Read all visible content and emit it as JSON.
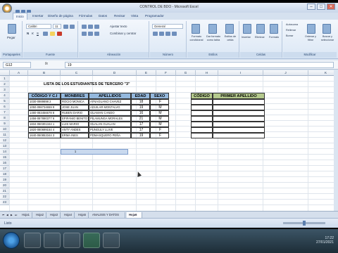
{
  "window": {
    "title": "CONTROL DE BDO - Microsoft Excel",
    "controls": [
      "–",
      "□",
      "✕"
    ]
  },
  "ribbon_tabs": [
    "Inicio",
    "Insertar",
    "Diseño de página",
    "Fórmulas",
    "Datos",
    "Revisar",
    "Vista",
    "Programador"
  ],
  "ribbon": {
    "paste_label": "Pegar",
    "font_name": "Calibri",
    "font_size": "11",
    "wrap_text": "Ajustar texto",
    "merge_center": "Combinar y centrar",
    "number_format": "General",
    "cond_format": "Formato condicional",
    "table_format": "Dar formato como tabla",
    "cell_styles": "Estilos de celda",
    "insert": "Insertar",
    "delete": "Eliminar",
    "format": "Formato",
    "autosum": "Autosuma",
    "fill": "Rellenar",
    "clear": "Borrar",
    "sort_filter": "Ordenar y filtrar",
    "find_select": "Buscar y seleccionar",
    "groups": [
      "Portapapeles",
      "Fuente",
      "Alineación",
      "Número",
      "Estilos",
      "Celdas",
      "Modificar"
    ]
  },
  "formula_bar": {
    "name_box": "G12",
    "fx": "fx",
    "value": "19"
  },
  "columns": [
    "A",
    "B",
    "C",
    "D",
    "E",
    "F",
    "G",
    "H",
    "I",
    "J",
    "K"
  ],
  "rows": [
    "1",
    "2",
    "3",
    "4",
    "5",
    "6",
    "7",
    "8",
    "9",
    "10",
    "11",
    "12",
    "13",
    "14",
    "15",
    "16",
    "17",
    "18",
    "19",
    "20",
    "21",
    "22",
    "23"
  ],
  "sheet_title": "LISTA DE LOS ESTUDIANTES DE TERCERO \"3\"",
  "table": {
    "headers": [
      "CÓDIGO Y C.I",
      "MONBRES",
      "APELLIDOS",
      "EDAD",
      "SEXO"
    ],
    "rows": [
      [
        "1030-0989898 2",
        "ROCIO MONICA",
        "AYNAGUANO CHAVEZ",
        "18",
        "F"
      ],
      [
        "1050-098734659 9",
        "JOSE JUAN",
        "AGUILAR MONTALVO",
        "19",
        "M"
      ],
      [
        "1480-083456678 8",
        "RUBEN DARIO",
        "GUAMAN CANDO",
        "16",
        "M"
      ],
      [
        "1456-087890377 6",
        "EPIFANIO BENITO",
        "PILAMUNGA MORALES",
        "21",
        "M"
      ],
      [
        "1834-060301344 1",
        "LUIS MARIO",
        "GUALAN GUALAN",
        "17",
        "M"
      ],
      [
        "1820-080699154 4",
        "ANTY ANDES",
        "PUNGULY LLIVE",
        "17",
        "F"
      ],
      [
        "1640-060853344 3",
        "ERMA INES",
        "POMASQUERO PEÑA",
        "19",
        "F"
      ]
    ]
  },
  "lookup": {
    "headers": [
      "CÓDIGO",
      "PRIMER APELLIDO"
    ]
  },
  "selected_cell_value": "1",
  "sheet_tabs": [
    "Hoja1",
    "Hoja2",
    "Hoja3",
    "Hoja4",
    "Hoja5",
    "ANALISIS Y DATOS",
    "Hoja6"
  ],
  "status": "Listo",
  "taskbar": {
    "clock_time": "17:22",
    "clock_date": "27/01/2021"
  }
}
